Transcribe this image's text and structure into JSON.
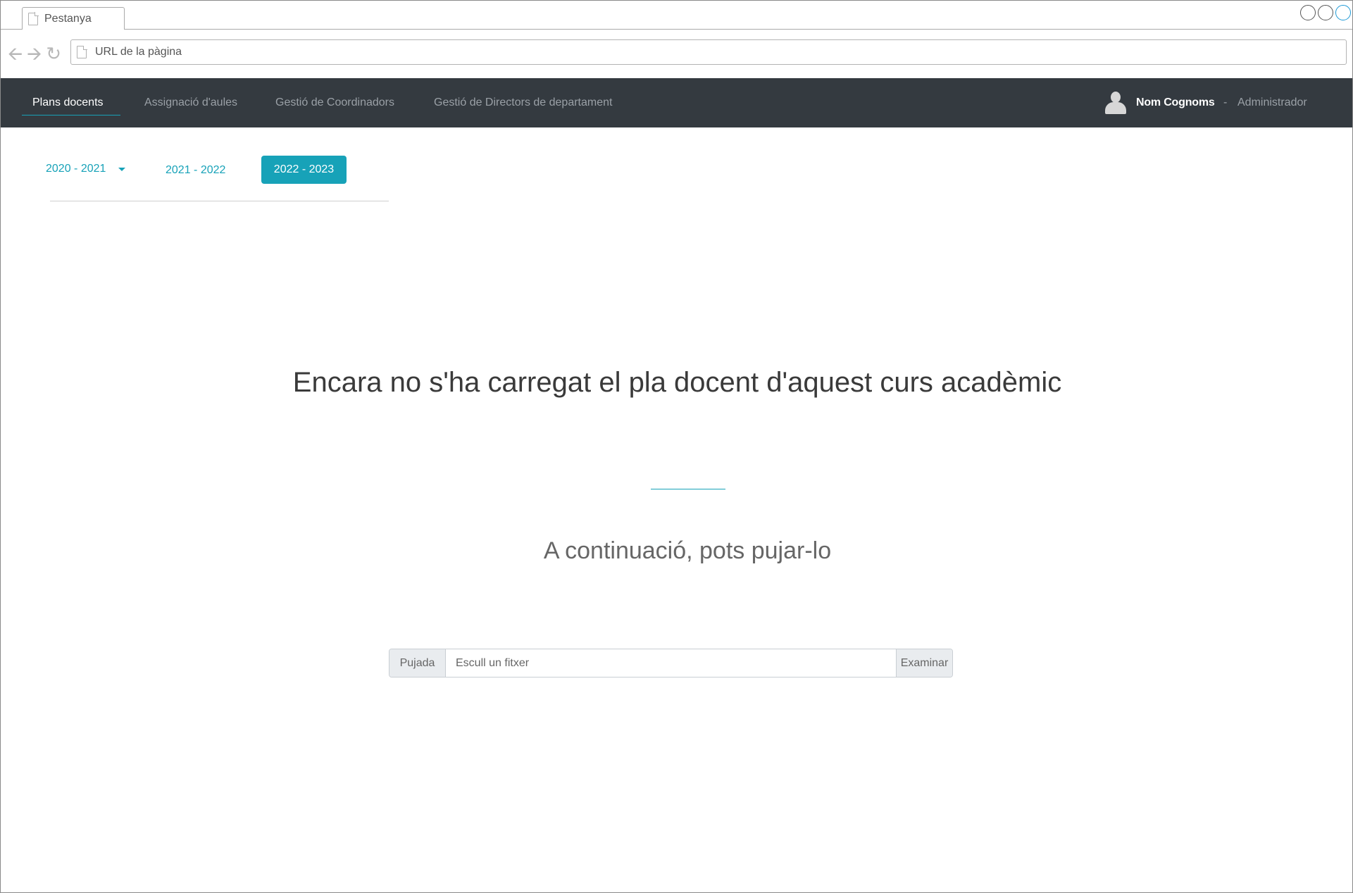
{
  "browser": {
    "tab_title": "Pestanya",
    "url_placeholder": "URL de la pàgina"
  },
  "navbar": {
    "items": [
      {
        "label": "Plans docents",
        "active": true
      },
      {
        "label": "Assignació d'aules",
        "active": false
      },
      {
        "label": "Gestió de Coordinadors",
        "active": false
      },
      {
        "label": "Gestió de Directors de departament",
        "active": false
      }
    ],
    "user": {
      "name": "Nom Cognoms",
      "separator": "-",
      "role": "Administrador"
    }
  },
  "years": {
    "items": [
      "2020 - 2021",
      "2021 - 2022",
      "2022 - 2023"
    ],
    "selected": "2022 - 2023"
  },
  "main": {
    "heading": "Encara no s'ha carregat el pla docent d'aquest curs acadèmic",
    "subheading": "A continuació, pots pujar-lo"
  },
  "upload": {
    "prefix": "Pujada",
    "placeholder": "Escull un fitxer",
    "button": "Examinar"
  },
  "colors": {
    "accent": "#17a2b8",
    "navbar_bg": "#343a40"
  }
}
